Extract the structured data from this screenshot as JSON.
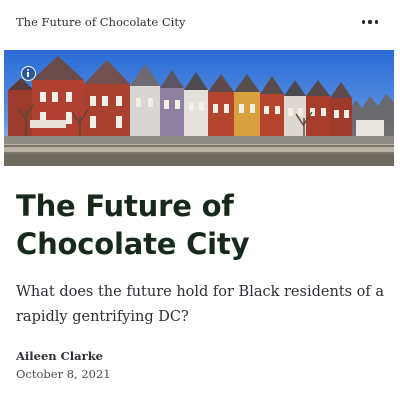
{
  "header": {
    "site_title": "The Future of Chocolate City",
    "more_icon": "more-horizontal-icon"
  },
  "hero": {
    "image_description": "row houses photo",
    "info_icon": "info-icon"
  },
  "article": {
    "title": "The Future of Chocolate City",
    "subtitle": "What does the future hold for Black residents of a rapidly gentrifying DC?",
    "author": "Aileen Clarke",
    "date": "October 8, 2021"
  },
  "colors": {
    "headline": "#17291c",
    "body_text": "#2c2f33",
    "sky": "#2e6fd6"
  }
}
